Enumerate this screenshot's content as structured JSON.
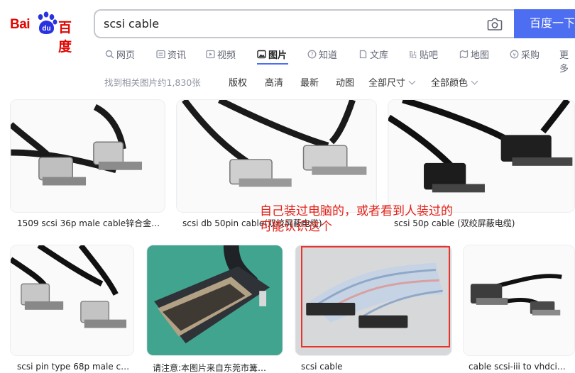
{
  "logo": {
    "text_left": "Bai",
    "paw_text": "du",
    "text_right": "百度"
  },
  "search": {
    "query": "scsi cable",
    "button_label": "百度一下"
  },
  "nav": [
    {
      "label": "网页",
      "icon": "search-icon"
    },
    {
      "label": "资讯",
      "icon": "news-icon"
    },
    {
      "label": "视频",
      "icon": "video-icon"
    },
    {
      "label": "图片",
      "icon": "image-icon",
      "active": true
    },
    {
      "label": "知道",
      "icon": "question-icon"
    },
    {
      "label": "文库",
      "icon": "doc-icon"
    },
    {
      "label": "贴吧",
      "icon": "tieba-icon"
    },
    {
      "label": "地图",
      "icon": "map-icon"
    },
    {
      "label": "采购",
      "icon": "purchase-icon"
    },
    {
      "label": "更多"
    }
  ],
  "filters": {
    "count": "找到相关图片约1,830张",
    "items": [
      "版权",
      "高清",
      "最新",
      "动图",
      "全部尺寸",
      "全部颜色"
    ]
  },
  "results": [
    {
      "caption": "1509 scsi 36p male cable锌合金…",
      "color": "light"
    },
    {
      "caption": "scsi db 50pin cable(双绞屏蔽电缆)",
      "color": "light"
    },
    {
      "caption": "scsi 50p cable (双绞屏蔽电缆)",
      "color": "dark"
    },
    {
      "caption": "scsi pin type 68p male ca…",
      "color": "light"
    },
    {
      "caption": "请注意:本图片来自东莞市篝…",
      "color": "closeup"
    },
    {
      "caption": "scsi cable",
      "color": "ribbon"
    },
    {
      "caption": "cable scsi-iii to vhdci…",
      "color": "dark2"
    }
  ],
  "annotation": {
    "line1": "自己装过电脑的，或者看到人装过的",
    "line2": "可能认识这个"
  },
  "colors": {
    "accent": "#4e6ef2",
    "brand": "#e10602",
    "annotation": "#e2231a"
  }
}
